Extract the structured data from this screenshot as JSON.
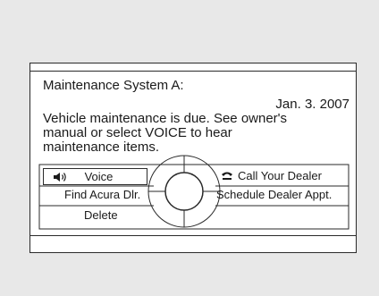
{
  "screen": {
    "title": "Maintenance System A:",
    "date": "Jan. 3. 2007",
    "message_lines": [
      "Vehicle maintenance is due. See owner's",
      "manual or select VOICE to hear",
      "maintenance items."
    ]
  },
  "menu": {
    "voice_label": "Voice",
    "call_label": "Call Your Dealer",
    "find_label": "Find Acura Dlr.",
    "schedule_label": "Schedule Dealer Appt.",
    "delete_label": "Delete",
    "selected_item": "Voice",
    "icons": {
      "voice": "speaker-icon",
      "call": "phone-icon",
      "center": "interface-dial-icon"
    }
  }
}
